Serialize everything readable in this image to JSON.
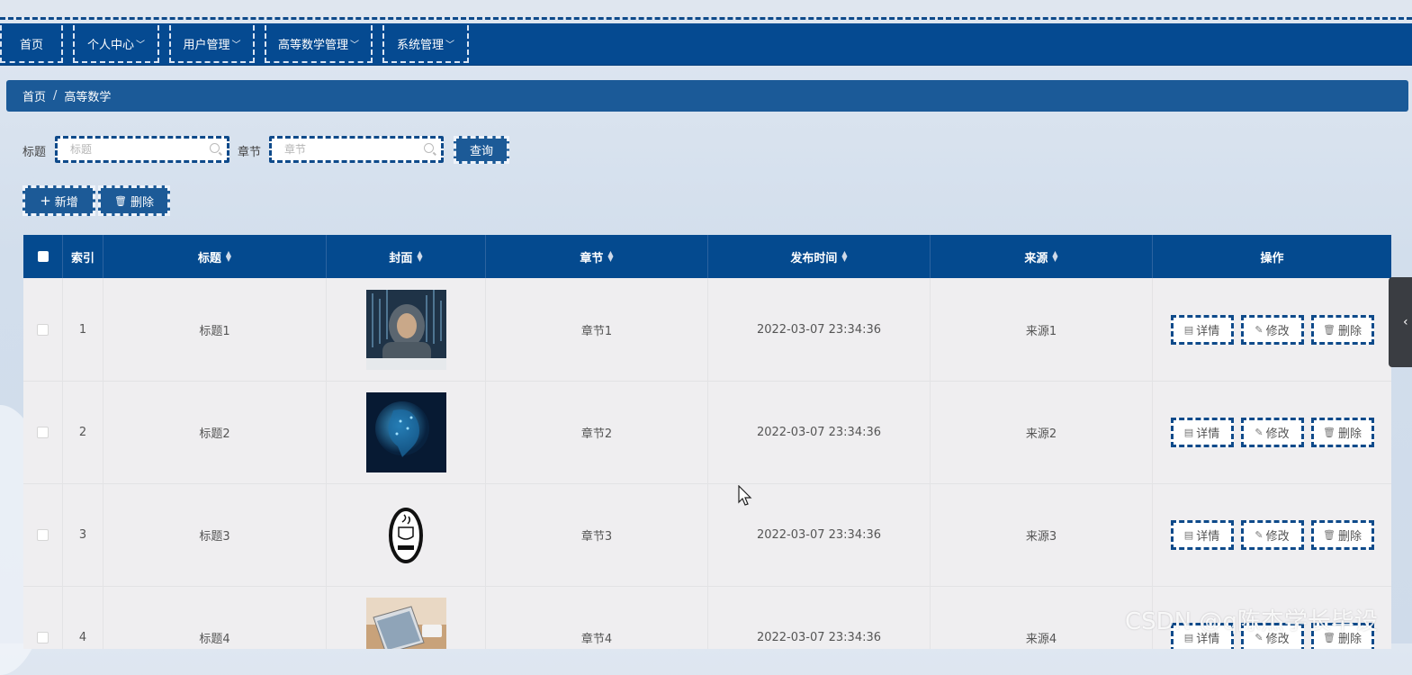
{
  "nav": {
    "items": [
      {
        "label": "首页",
        "dropdown": false
      },
      {
        "label": "个人中心",
        "dropdown": true
      },
      {
        "label": "用户管理",
        "dropdown": true
      },
      {
        "label": "高等数学管理",
        "dropdown": true
      },
      {
        "label": "系统管理",
        "dropdown": true
      }
    ]
  },
  "breadcrumb": {
    "home": "首页",
    "separator": "/",
    "current": "高等数学"
  },
  "search": {
    "title_label": "标题",
    "title_placeholder": "标题",
    "chapter_label": "章节",
    "chapter_placeholder": "章节",
    "query_button": "查询"
  },
  "actions": {
    "add": "新增",
    "delete": "删除",
    "add_icon": "plus-icon",
    "delete_icon": "trash-icon"
  },
  "table": {
    "columns": [
      "索引",
      "标题",
      "封面",
      "章节",
      "发布时间",
      "来源",
      "操作"
    ],
    "rows": [
      {
        "index": "1",
        "title": "标题1",
        "cover": "hacker-image",
        "chapter": "章节1",
        "time": "2022-03-07 23:34:36",
        "source": "来源1"
      },
      {
        "index": "2",
        "title": "标题2",
        "cover": "ai-head-image",
        "chapter": "章节2",
        "time": "2022-03-07 23:34:36",
        "source": "来源2"
      },
      {
        "index": "3",
        "title": "标题3",
        "cover": "java-logo-image",
        "chapter": "章节3",
        "time": "2022-03-07 23:34:36",
        "source": "来源3"
      },
      {
        "index": "4",
        "title": "标题4",
        "cover": "laptop-image",
        "chapter": "章节4",
        "time": "2022-03-07 23:34:36",
        "source": "来源4"
      }
    ],
    "row_actions": {
      "detail": "详情",
      "edit": "修改",
      "delete": "删除"
    }
  },
  "watermark": "CSDN @q陈杰学长毕设",
  "colors": {
    "primary": "#054a91",
    "breadcrumb": "#1b5a98",
    "button": "#1c5a97",
    "dash": "#0e4a8a"
  }
}
